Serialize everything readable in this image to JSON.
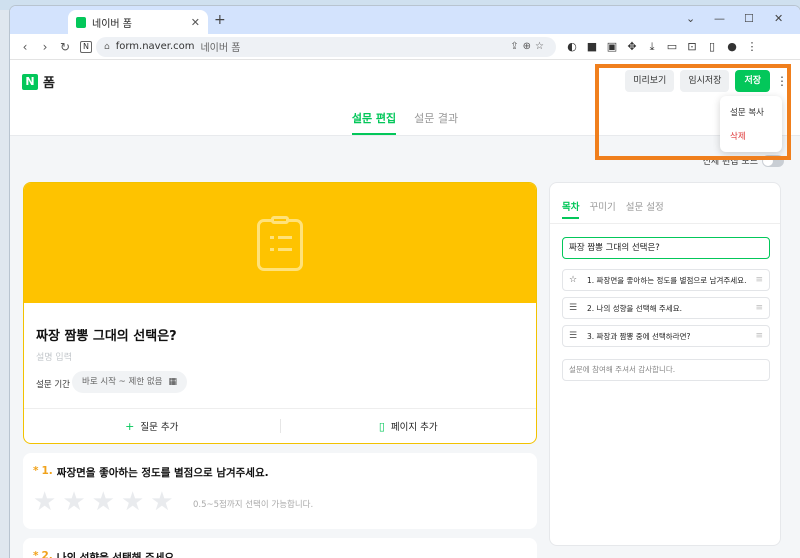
{
  "browser": {
    "tab_title": "네이버 폼",
    "tab_close": "✕",
    "new_tab": "+",
    "win_min": "—",
    "win_max": "☐",
    "win_close": "✕",
    "url_site": "form.naver.com",
    "url_title": "네이버 폼",
    "nav_n": "N"
  },
  "app": {
    "logo_mark": "N",
    "logo_text": "폼",
    "preview_label": "미리보기",
    "temp_save_label": "임시저장",
    "save_label": "저장",
    "kebab": "⋮",
    "menu": {
      "copy_label": "설문 복사",
      "delete_label": "삭제"
    },
    "tabs": [
      {
        "label": "설문 편집",
        "active": true
      },
      {
        "label": "설문 결과",
        "active": false
      }
    ],
    "toggle_label": "전체 편집 모드"
  },
  "form": {
    "title": "짜장 짬뽕 그대의 선택은?",
    "description_placeholder": "설명 입력",
    "period_label": "설문 기간",
    "period_value": "바로 시작 ~ 제한 없음",
    "add_question_label": "질문 추가",
    "add_page_label": "페이지 추가"
  },
  "questions": [
    {
      "num": "1.",
      "required": "*",
      "title": "짜장면을 좋아하는 정도를 별점으로 남겨주세요.",
      "note": "0.5~5점까지 선택이 가능합니다."
    },
    {
      "num": "2.",
      "required": "*",
      "title": "나의 성향을 선택해 주세요."
    }
  ],
  "panel": {
    "tabs": [
      {
        "label": "목차",
        "active": true
      },
      {
        "label": "꾸미기",
        "active": false
      },
      {
        "label": "설문 설정",
        "active": false
      }
    ],
    "title": "짜장 짬뽕 그대의 선택은?",
    "items": [
      {
        "label": "1. 짜장면을 좋아하는 정도를 별점으로 남겨주세요.",
        "icon": "star-icon"
      },
      {
        "label": "2. 나의 성향을 선택해 주세요.",
        "icon": "list-icon"
      },
      {
        "label": "3. 짜장과 짬뽕 중에 선택하라면?",
        "icon": "list-icon"
      }
    ],
    "ending": "설문에 참여해 주셔서 감사합니다."
  },
  "colors": {
    "brand_green": "#03c75a",
    "banner_yellow": "#fec300",
    "danger_red": "#e03b3b",
    "highlight_orange": "#f07f1d"
  }
}
